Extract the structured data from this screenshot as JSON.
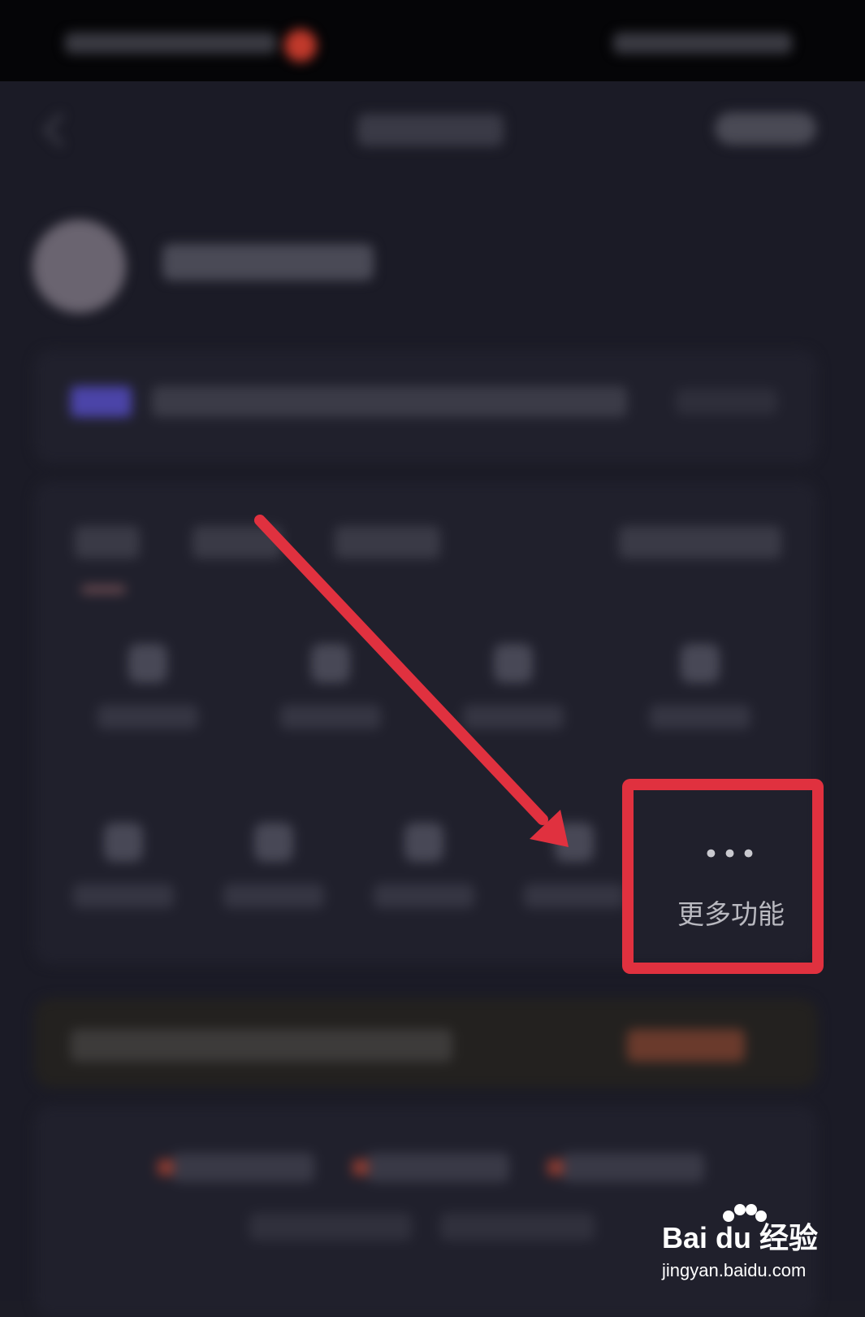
{
  "more_button": {
    "icon": "more-dots-icon",
    "icon_glyph": "•••",
    "label": "更多功能"
  },
  "annotation": {
    "highlight_color": "#e0313f"
  },
  "watermark": {
    "logo": "Bai du 经验",
    "url": "jingyan.baidu.com"
  }
}
